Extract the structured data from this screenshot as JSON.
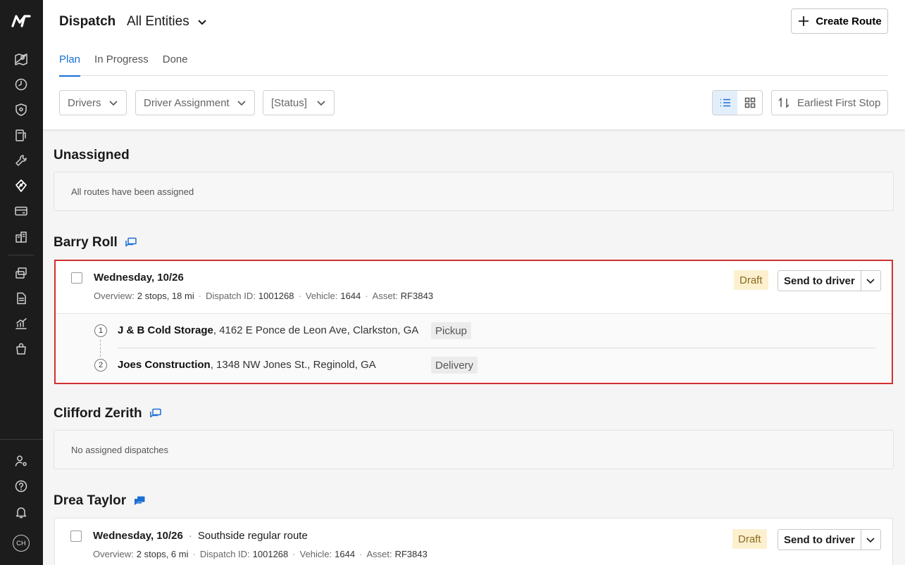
{
  "sidebar": {
    "logo_text": "M",
    "nav_icons": [
      "map-icon",
      "clock-icon",
      "shield-icon",
      "fuel-icon",
      "wrench-icon",
      "dispatch-icon",
      "credit-card-icon",
      "buildings-icon",
      "documents-icon",
      "file-icon",
      "chart-icon",
      "bag-icon"
    ],
    "bottom_icons": [
      "user-settings-icon",
      "help-icon",
      "bell-icon"
    ],
    "avatar_initials": "CH"
  },
  "header": {
    "title": "Dispatch",
    "entity_selector": "All Entities",
    "create_route_label": "Create Route",
    "tabs": [
      {
        "label": "Plan",
        "active": true
      },
      {
        "label": "In Progress",
        "active": false
      },
      {
        "label": "Done",
        "active": false
      }
    ],
    "filters": {
      "drivers": "Drivers",
      "driver_assignment": "Driver Assignment",
      "status": "[Status]"
    },
    "sort_label": "Earliest First Stop",
    "accent_color": "#1a6fd4"
  },
  "sections": {
    "unassigned": {
      "title": "Unassigned",
      "message": "All routes have been assigned"
    },
    "barry": {
      "name": "Barry Roll",
      "route": {
        "date": "Wednesday, 10/26",
        "overview_label": "Overview:",
        "overview_value": "2 stops, 18 mi",
        "dispatch_label": "Dispatch ID:",
        "dispatch_id": "1001268",
        "vehicle_label": "Vehicle:",
        "vehicle": "1644",
        "asset_label": "Asset:",
        "asset": "RF3843",
        "status": "Draft",
        "send_label": "Send to driver",
        "stops": [
          {
            "num": "1",
            "name": "J & B Cold Storage",
            "address": ", 4162 E Ponce de Leon Ave, Clarkston, GA",
            "type": "Pickup"
          },
          {
            "num": "2",
            "name": "Joes Construction",
            "address": ", 1348 NW Jones St., Reginold, GA",
            "type": "Delivery"
          }
        ]
      }
    },
    "clifford": {
      "name": "Clifford Zerith",
      "message": "No assigned dispatches"
    },
    "drea": {
      "name": "Drea Taylor",
      "route": {
        "date": "Wednesday, 10/26",
        "route_name": "Southside regular route",
        "overview_label": "Overview:",
        "overview_value": "2 stops, 6 mi",
        "dispatch_label": "Dispatch ID:",
        "dispatch_id": "1001268",
        "vehicle_label": "Vehicle:",
        "vehicle": "1644",
        "asset_label": "Asset:",
        "asset": "RF3843",
        "status": "Draft",
        "send_label": "Send to driver"
      }
    }
  }
}
